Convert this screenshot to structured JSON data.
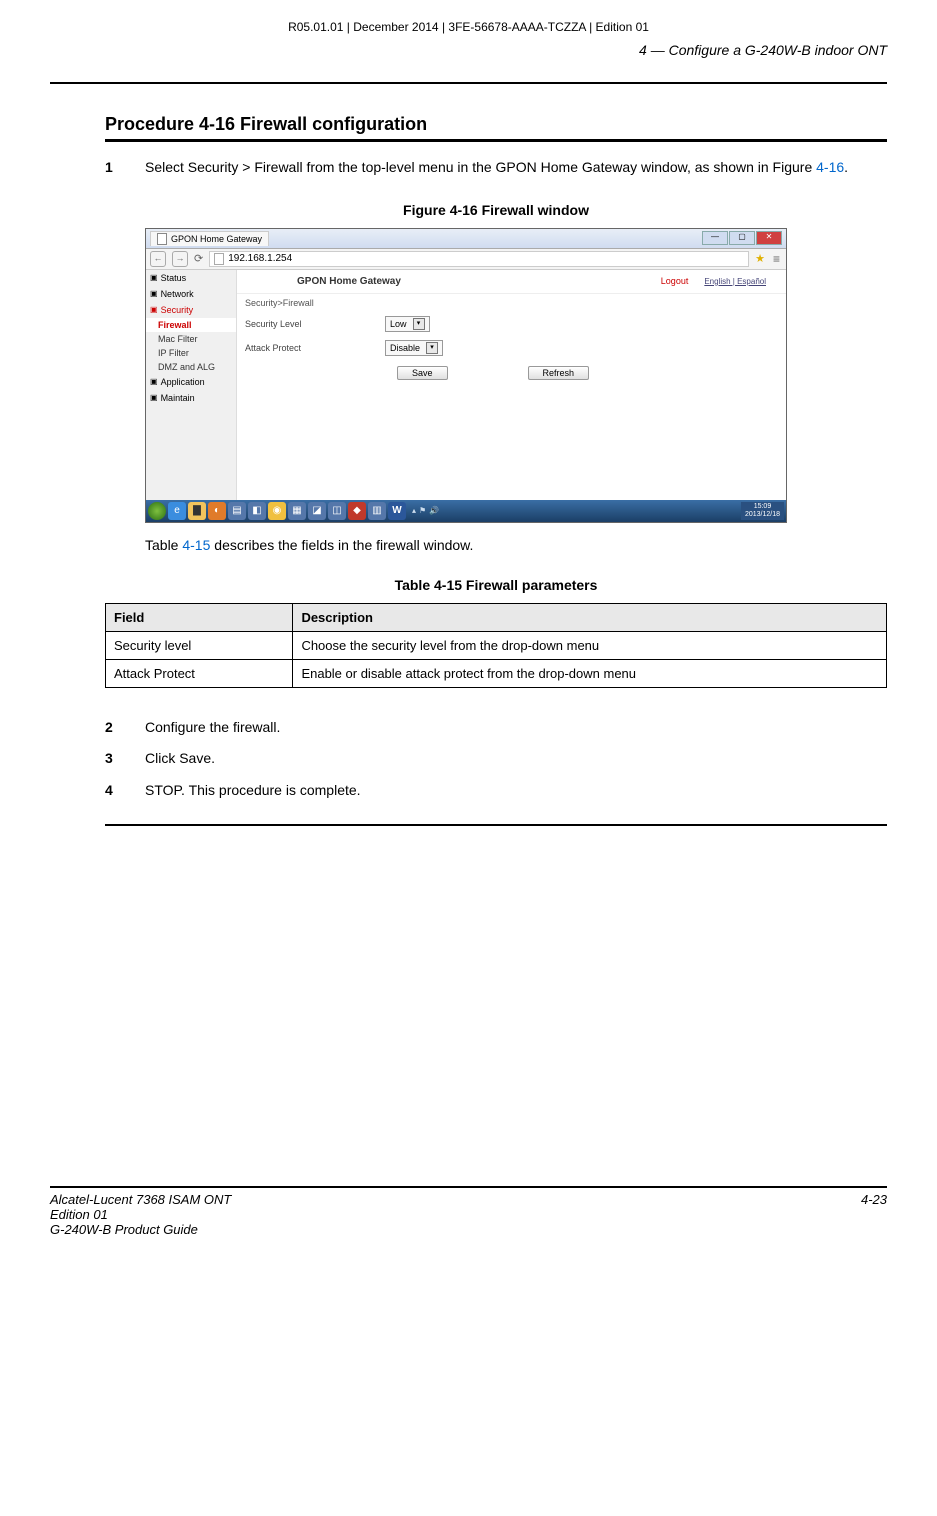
{
  "doc_header": "R05.01.01 | December 2014 | 3FE-56678-AAAA-TCZZA | Edition 01",
  "section_header": "4 —  Configure a G-240W-B indoor ONT",
  "procedure_title": "Procedure 4-16  Firewall configuration",
  "steps": {
    "s1_num": "1",
    "s1_text_a": "Select Security > Firewall from the top-level menu in the GPON Home Gateway window, as shown in Figure ",
    "s1_link": "4-16",
    "s1_text_b": ".",
    "s2_num": "2",
    "s2_text": "Configure the firewall.",
    "s3_num": "3",
    "s3_text": "Click Save.",
    "s4_num": "4",
    "s4_text": "STOP. This procedure is complete."
  },
  "figure_caption": "Figure 4-16  Firewall window",
  "table_link_sentence_a": "Table ",
  "table_link": "4-15",
  "table_link_sentence_b": " describes the fields in the firewall window.",
  "table_caption": "Table 4-15 Firewall parameters",
  "table": {
    "h1": "Field",
    "h2": "Description",
    "rows": [
      {
        "field": "Security level",
        "desc": "Choose the security level from the drop-down menu"
      },
      {
        "field": "Attack Protect",
        "desc": "Enable or disable attack protect from the drop-down menu"
      }
    ]
  },
  "footer": {
    "left1": "Alcatel-Lucent 7368 ISAM ONT",
    "left2": "Edition 01",
    "left3": "G-240W-B Product Guide",
    "right": "4-23"
  },
  "screenshot": {
    "tab_title": "GPON Home Gateway",
    "url": "192.168.1.254",
    "router_title": "GPON Home Gateway",
    "logout": "Logout",
    "lang": "English | Español",
    "breadcrumb": "Security>Firewall",
    "sidebar": {
      "status": "Status",
      "network": "Network",
      "security": "Security",
      "firewall": "Firewall",
      "mac_filter": "Mac Filter",
      "ip_filter": "IP Filter",
      "dmz_alg": "DMZ and ALG",
      "application": "Application",
      "maintain": "Maintain"
    },
    "form": {
      "sec_level_label": "Security Level",
      "sec_level_value": "Low",
      "attack_label": "Attack Protect",
      "attack_value": "Disable",
      "save": "Save",
      "refresh": "Refresh"
    },
    "taskbar": {
      "time": "15:09",
      "date": "2013/12/18"
    }
  }
}
